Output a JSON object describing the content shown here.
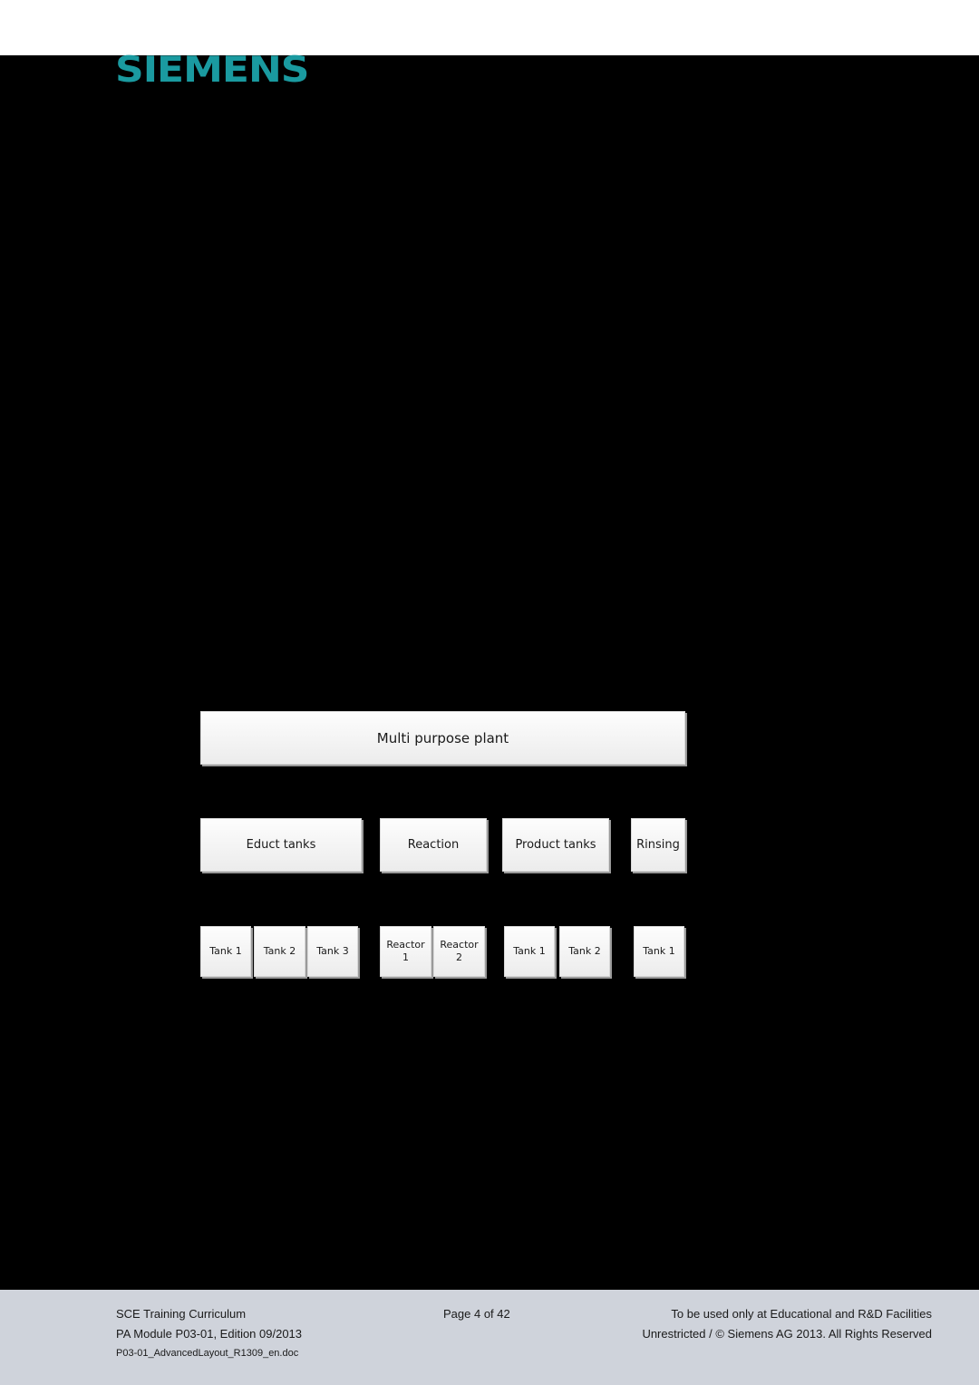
{
  "header": {
    "logo_text": "SIEMENS",
    "logo_color": "#1a9aa0"
  },
  "diagram": {
    "root": {
      "label": "Multi purpose plant"
    },
    "groups": [
      {
        "label": "Educt tanks",
        "children": [
          "Tank 1",
          "Tank 2",
          "Tank 3"
        ]
      },
      {
        "label": "Reaction",
        "children": [
          "Reactor\n1",
          "Reactor\n2"
        ]
      },
      {
        "label": "Product tanks",
        "children": [
          "Tank 1",
          "Tank 2"
        ]
      },
      {
        "label": "Rinsing",
        "children": [
          "Tank 1"
        ]
      }
    ]
  },
  "footer": {
    "left_line1": "SCE Training Curriculum",
    "left_line2": "PA Module P03-01, Edition 09/2013",
    "left_line3": "P03-01_AdvancedLayout_R1309_en.doc",
    "page": "Page 4 of 42",
    "right_line1": "To be used only at Educational and R&D Facilities",
    "right_line2": "Unrestricted / © Siemens AG 2013. All Rights Reserved",
    "background": "#cfd3db"
  }
}
